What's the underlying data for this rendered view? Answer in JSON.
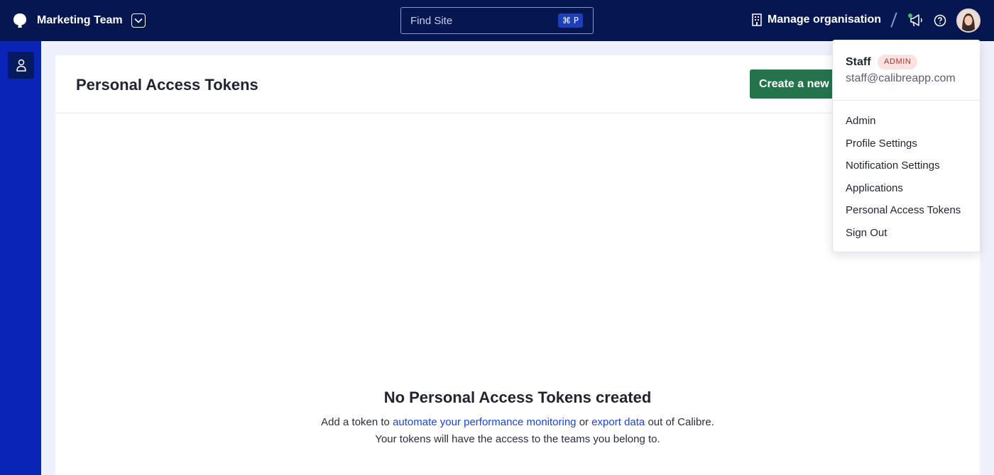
{
  "topbar": {
    "team_name": "Marketing Team",
    "search_placeholder": "Find Site",
    "search_shortcut": "⌘ P",
    "manage_org_label": "Manage organisation"
  },
  "page": {
    "title": "Personal Access Tokens",
    "create_button_label": "Create a new token"
  },
  "empty_state": {
    "title": "No Personal Access Tokens created",
    "desc_part1": "Add a token to ",
    "link1": "automate your performance monitoring",
    "desc_part2": " or ",
    "link2": "export data",
    "desc_part3": " out of Calibre. Your tokens will have the access to the teams you belong to."
  },
  "user_menu": {
    "name": "Staff",
    "badge": "ADMIN",
    "email": "staff@calibreapp.com",
    "items": [
      "Admin",
      "Profile Settings",
      "Notification Settings",
      "Applications",
      "Personal Access Tokens",
      "Sign Out"
    ]
  },
  "colors": {
    "topbar_bg": "#051650",
    "sidebar_bg": "#0b24b8",
    "primary_button": "#23744c",
    "link": "#1a45d4",
    "admin_badge_bg": "#fde2e1",
    "admin_badge_text": "#a8322c"
  },
  "icons": [
    "calibre-logo-icon",
    "chevron-down-icon",
    "building-icon",
    "megaphone-icon",
    "help-circle-icon",
    "user-icon"
  ]
}
